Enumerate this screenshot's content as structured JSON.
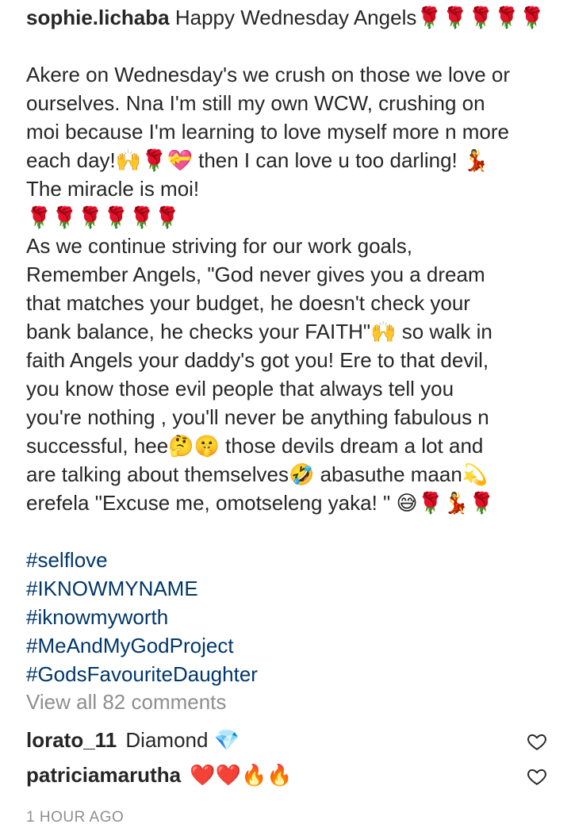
{
  "post": {
    "username": "sophie.lichaba",
    "caption_lines": [
      "Happy Wednesday Angels🌹🌹🌹🌹🌹",
      "",
      "Akere on Wednesday's we crush on those we love or",
      "ourselves. Nna I'm still my own WCW, crushing on",
      "moi because I'm learning to love myself more n more",
      "each day!🙌🌹💝 then I can love u too darling! 💃",
      "The miracle is moi!",
      "🌹🌹🌹🌹🌹🌹",
      "As we continue striving for our work goals,",
      "Remember Angels, \"God never gives you a dream",
      "that matches your budget, he doesn't check your",
      "bank balance, he checks your FAITH\"🙌 so walk in",
      "faith Angels your daddy's got you! Ere to that devil,",
      "you know those evil people that always tell you",
      "you're nothing , you'll never be anything fabulous n",
      "successful, hee🤔🤫 those devils dream a lot and",
      "are talking about themselves🤣 abasuthe maan💫",
      "erefela \"Excuse me, omotseleng yaka! \" 😅🌹💃🌹"
    ],
    "hashtags": [
      "#selflove",
      "#IKNOWMYNAME",
      "#iknowmyworth",
      "#MeAndMyGodProject",
      "#GodsFavouriteDaughter"
    ],
    "view_all_comments": "View all 82 comments",
    "comments": [
      {
        "username": "lorato_11",
        "text": "Diamond 💎"
      },
      {
        "username": "patriciamarutha",
        "text": "❤️❤️🔥🔥"
      }
    ],
    "timestamp": "1 HOUR AGO"
  },
  "icons": [
    "heart-outline-icon"
  ],
  "colors": {
    "text": "#262626",
    "hashtag": "#00376b",
    "muted": "#8e8e8e"
  }
}
